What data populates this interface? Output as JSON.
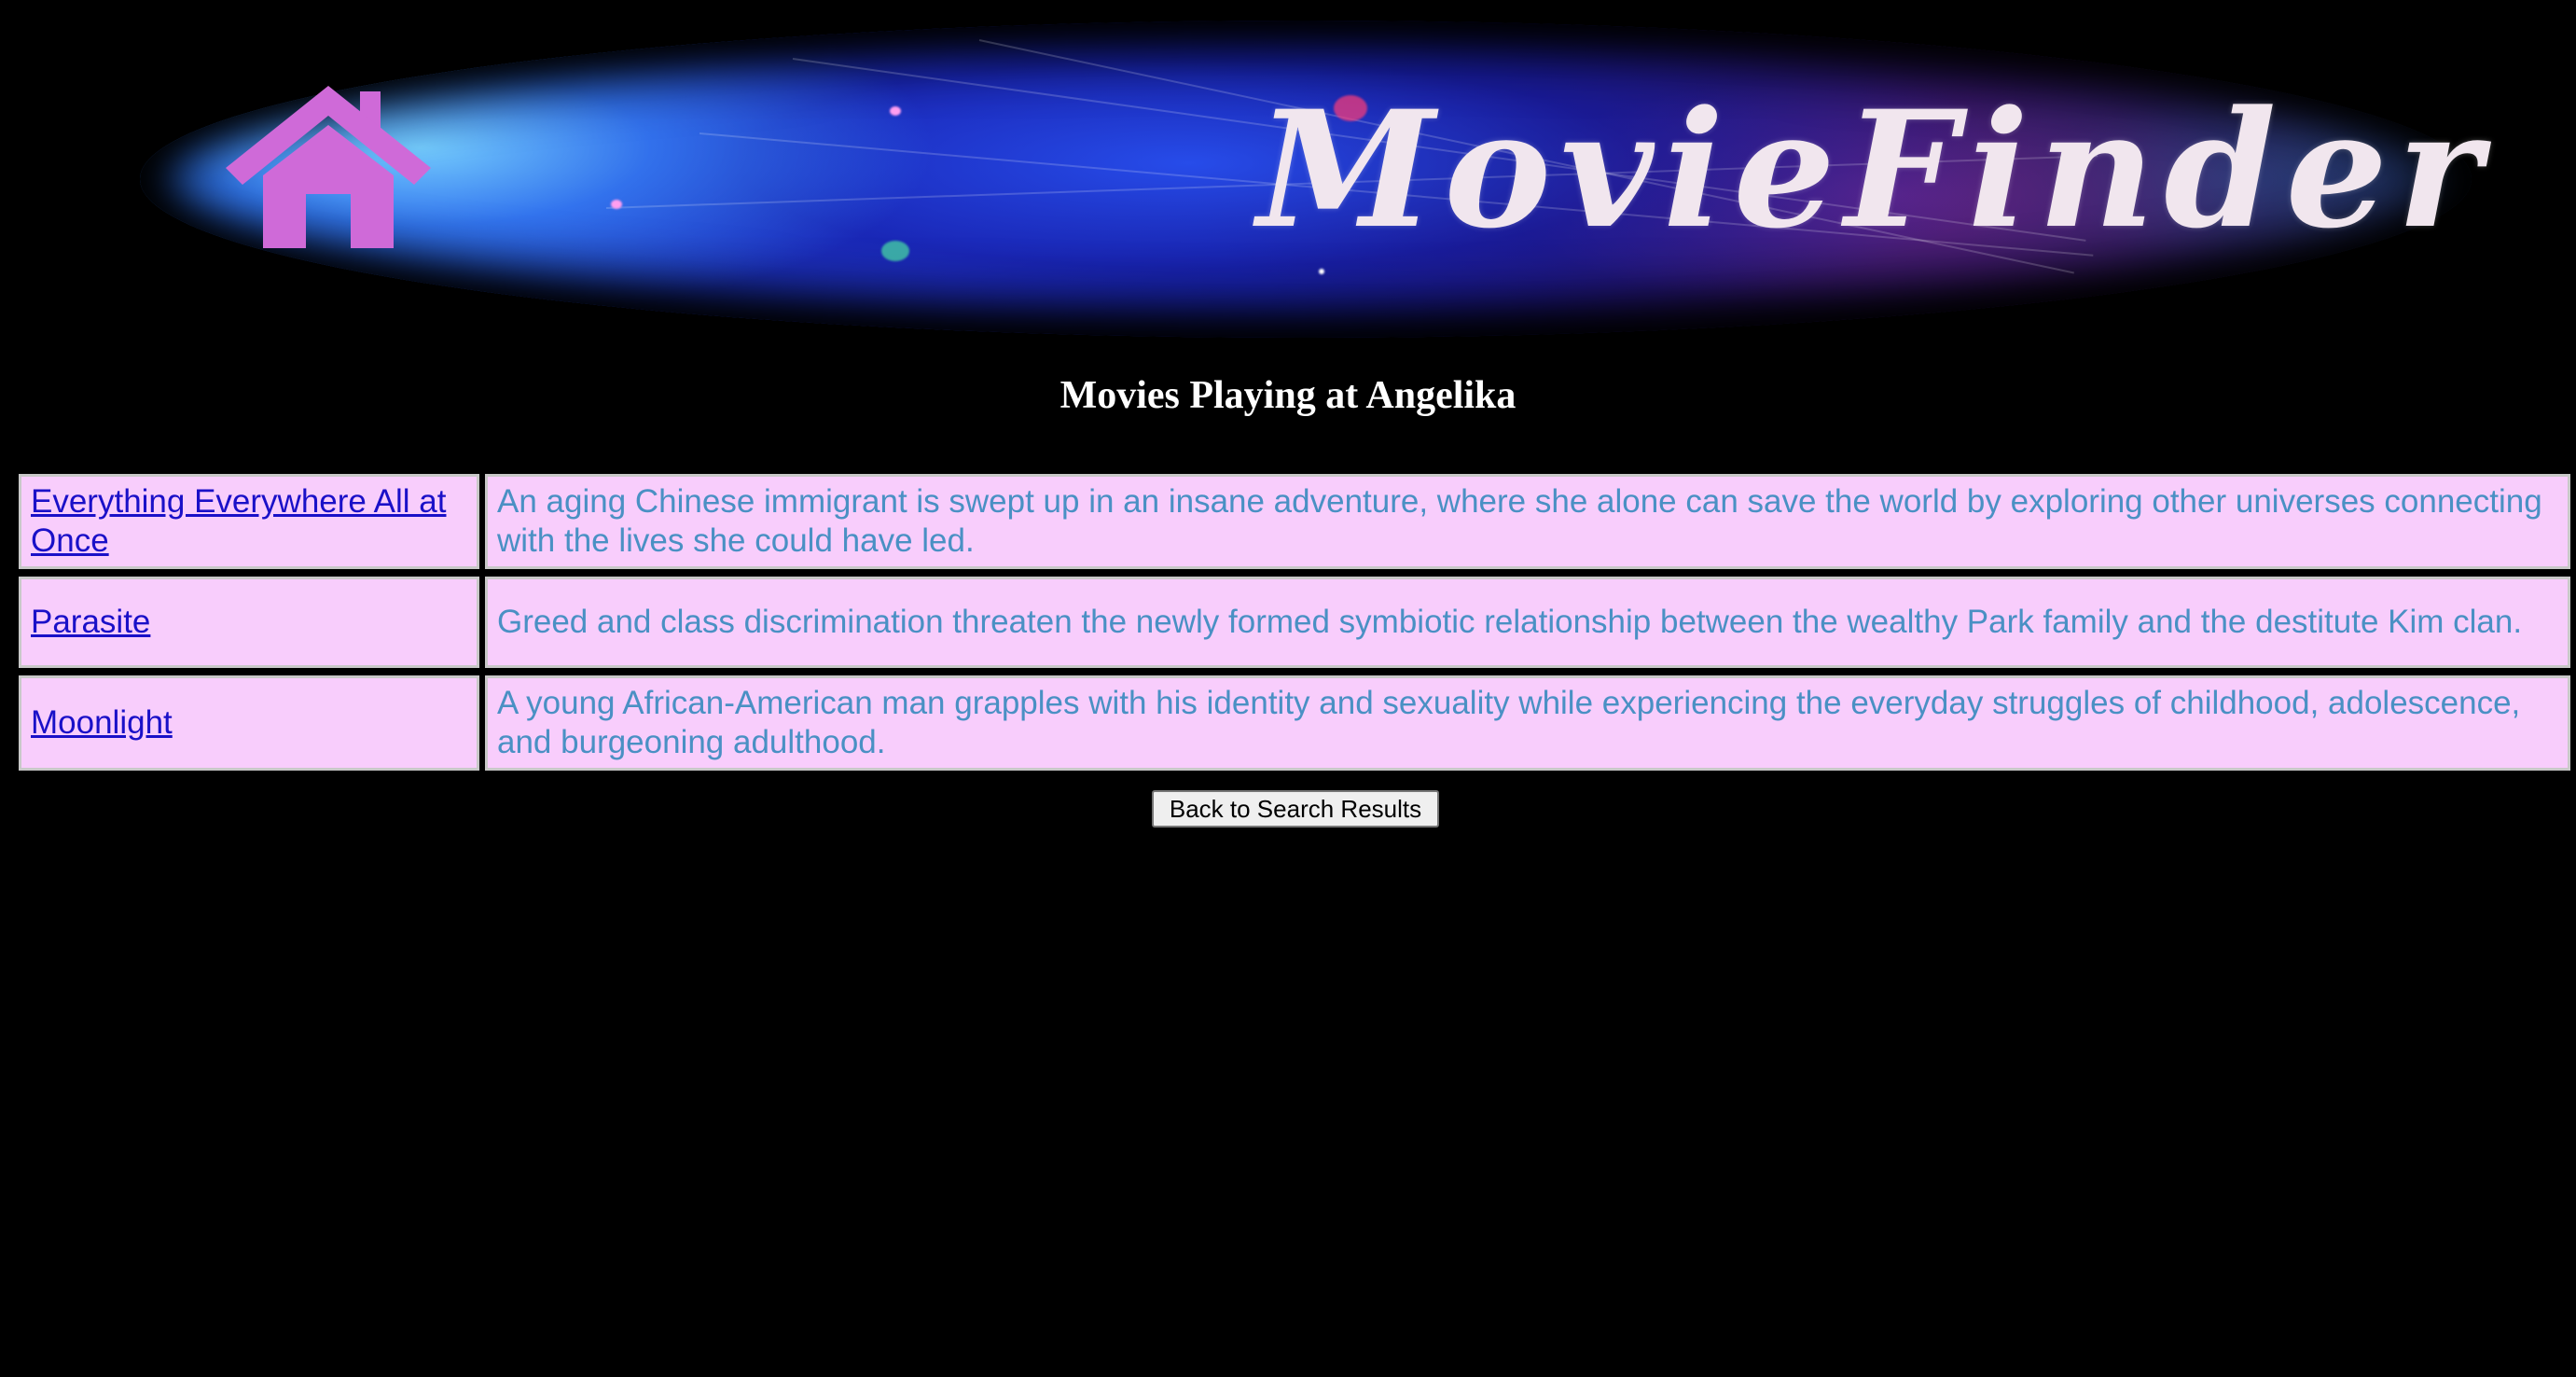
{
  "banner": {
    "logo_text": "MovieFinder",
    "home_icon": "house-icon",
    "colors": {
      "house": "#cf6ad8",
      "logo": "#f1e6ee"
    }
  },
  "page": {
    "title": "Movies Playing at Angelika"
  },
  "movies": [
    {
      "title": "Everything Everywhere All at Once",
      "synopsis": "An aging Chinese immigrant is swept up in an insane adventure, where she alone can save the world by exploring other universes connecting with the lives she could have led."
    },
    {
      "title": "Parasite",
      "synopsis": "Greed and class discrimination threaten the newly formed symbiotic relationship between the wealthy Park family and the destitute Kim clan."
    },
    {
      "title": "Moonlight",
      "synopsis": "A young African-American man grapples with his identity and sexuality while experiencing the everyday struggles of childhood, adolescence, and burgeoning adulthood."
    }
  ],
  "actions": {
    "back_label": "Back to Search Results"
  },
  "theme": {
    "background": "#000000",
    "cell_background": "#f8cdfc",
    "link_color": "#1a10c8",
    "synopsis_color": "#4a90c4"
  }
}
